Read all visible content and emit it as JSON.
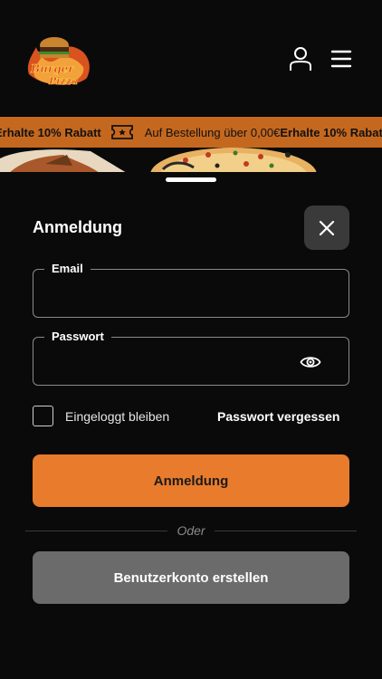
{
  "header": {
    "logo_text": "Burger Pizza",
    "icons": {
      "account": "user-icon",
      "menu": "hamburger-menu-icon"
    }
  },
  "ticker": {
    "promo": "Erhalte 10% Rabatt",
    "text": "Auf Bestellung über 0,00€",
    "icon": "ticket-icon"
  },
  "login": {
    "title": "Anmeldung",
    "email_label": "Email",
    "email_value": "",
    "password_label": "Passwort",
    "password_value": "",
    "remember_label": "Eingeloggt bleiben",
    "remember_checked": false,
    "forgot_label": "Passwort vergessen",
    "submit_label": "Anmeldung",
    "divider_label": "Oder",
    "register_label": "Benutzerkonto erstellen"
  },
  "colors": {
    "accent": "#e87b2c",
    "ticker_bg": "#c5681f",
    "background": "#0a0a0a",
    "secondary_button": "#6b6b6b"
  }
}
